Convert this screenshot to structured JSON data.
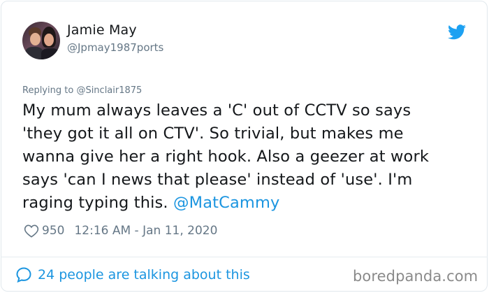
{
  "user": {
    "name": "Jamie May",
    "handle": "@Jpmay1987ports"
  },
  "reply": {
    "prefix": "Replying to",
    "to": "@Sinclair1875"
  },
  "tweet": {
    "lines": [
      "My mum always leaves a 'C' out of CCTV so says",
      "'they got it all on CTV'. So trivial, but makes me",
      "wanna give her a right hook. Also a geezer at work",
      "says 'can I news that please' instead of 'use'. I'm",
      "raging typing this. "
    ],
    "mention": "@MatCammy"
  },
  "meta": {
    "likes": "950",
    "timestamp": "12:16 AM - Jan 11, 2020"
  },
  "footer": {
    "talking": "24 people are talking about this",
    "watermark": "boredpanda.com"
  },
  "colors": {
    "link": "#1b95e0",
    "muted": "#657786",
    "text": "#14171a"
  },
  "icons": {
    "brand": "twitter-bird-icon",
    "like": "heart-icon",
    "reply": "speech-bubble-icon"
  }
}
